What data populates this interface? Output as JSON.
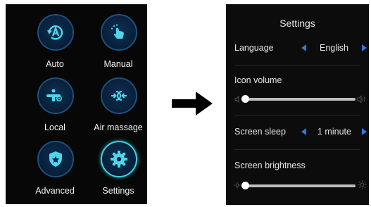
{
  "main_menu": {
    "tiles": [
      {
        "label": "Auto",
        "icon": "auto-a-icon"
      },
      {
        "label": "Manual",
        "icon": "hand-pointer-icon"
      },
      {
        "label": "Local",
        "icon": "local-massage-icon"
      },
      {
        "label": "Air massage",
        "icon": "air-arrows-icon"
      },
      {
        "label": "Advanced",
        "icon": "shield-star-icon"
      },
      {
        "label": "Settings",
        "icon": "gear-icon",
        "selected": true
      }
    ]
  },
  "arrow_icon": "right-arrow-icon",
  "settings": {
    "title": "Settings",
    "language": {
      "label": "Language",
      "value": "English"
    },
    "icon_volume": {
      "label": "Icon volume",
      "level": 0.08
    },
    "screen_sleep": {
      "label": "Screen sleep",
      "value": "1 minute"
    },
    "screen_brightness": {
      "label": "Screen brightness",
      "level": 0.08
    }
  },
  "colors": {
    "accent_blue": "#2b78e4",
    "icon_cyan": "#4fd6ea",
    "panel_bg": "#0c0c0c"
  }
}
